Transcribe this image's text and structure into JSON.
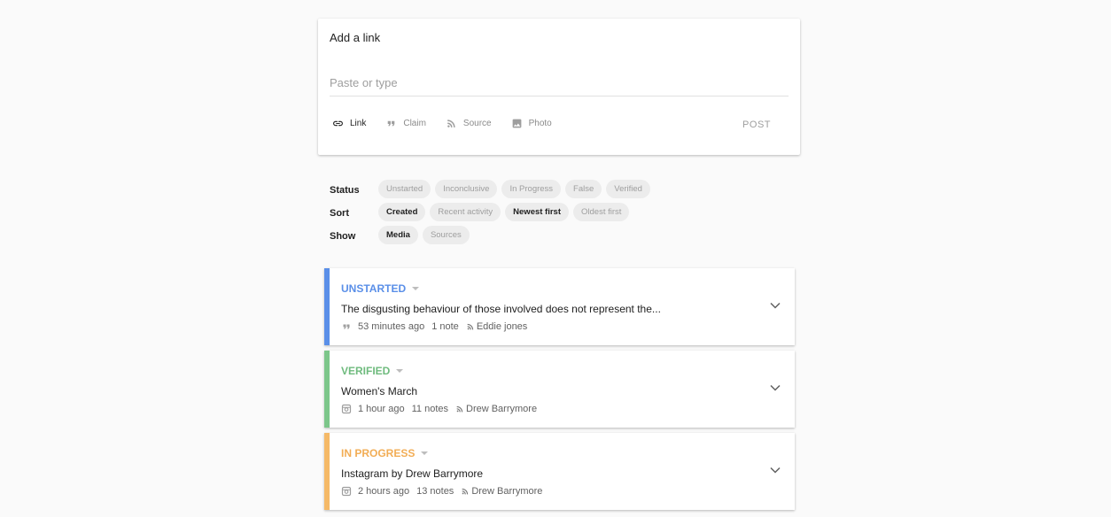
{
  "composer": {
    "title": "Add a link",
    "placeholder": "Paste or type",
    "types": [
      {
        "label": "Link",
        "icon": "link-icon",
        "active": true
      },
      {
        "label": "Claim",
        "icon": "quote-icon",
        "active": false
      },
      {
        "label": "Source",
        "icon": "rss-icon",
        "active": false
      },
      {
        "label": "Photo",
        "icon": "photo-icon",
        "active": false
      }
    ],
    "post_label": "POST"
  },
  "filters": {
    "status": {
      "label": "Status",
      "options": [
        "Unstarted",
        "Inconclusive",
        "In Progress",
        "False",
        "Verified"
      ],
      "selected": []
    },
    "sort": {
      "label": "Sort",
      "options": [
        "Created",
        "Recent activity",
        "Newest first",
        "Oldest first"
      ],
      "selected": [
        "Created",
        "Newest first"
      ]
    },
    "show": {
      "label": "Show",
      "options": [
        "Media",
        "Sources"
      ],
      "selected": [
        "Media"
      ]
    }
  },
  "stories": [
    {
      "status": "UNSTARTED",
      "status_color": "#5a8fe8",
      "title": "The disgusting behaviour of those involved does not represent the...",
      "type_icon": "quote-icon",
      "time": "53 minutes ago",
      "notes": "1 note",
      "source": "Eddie jones"
    },
    {
      "status": "VERIFIED",
      "status_color": "#7cc68a",
      "title": "Women's March",
      "type_icon": "instagram-icon",
      "time": "1 hour ago",
      "notes": "11 notes",
      "source": "Drew Barrymore"
    },
    {
      "status": "IN PROGRESS",
      "status_color": "#f5b967",
      "title": "Instagram by Drew Barrymore",
      "type_icon": "instagram-icon",
      "time": "2 hours ago",
      "notes": "13 notes",
      "source": "Drew Barrymore"
    }
  ]
}
